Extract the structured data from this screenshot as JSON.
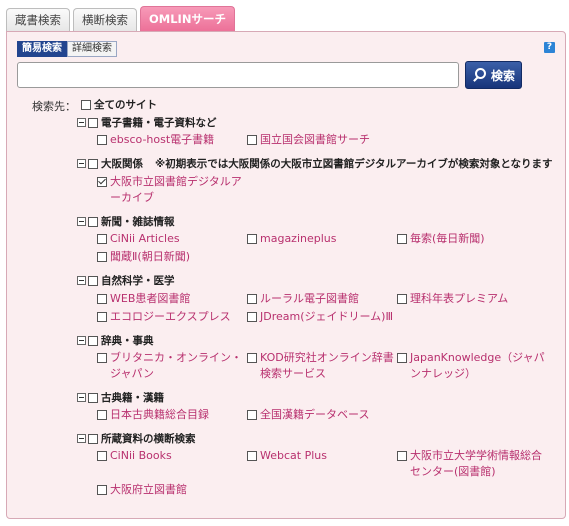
{
  "tabs": [
    {
      "label": "蔵書検索",
      "active": false
    },
    {
      "label": "横断検索",
      "active": false
    },
    {
      "label": "OMLINサーチ",
      "active": true
    }
  ],
  "subtabs": [
    {
      "label": "簡易検索",
      "active": true
    },
    {
      "label": "詳細検索",
      "active": false
    }
  ],
  "help_icon": "?",
  "search": {
    "value": "",
    "button_label": "検索",
    "button_icon": "search-icon"
  },
  "target_label": "検索先：",
  "all_sites_label": "全てのサイト",
  "categories": [
    {
      "name": "電子書籍・電子資料など",
      "items": [
        {
          "label": "ebsco-host電子書籍",
          "checked": false
        },
        {
          "label": "国立国会図書館サーチ",
          "checked": false
        }
      ]
    },
    {
      "name": "大阪関係",
      "note": "※初期表示では大阪関係の大阪市立図書館デジタルアーカイブが検索対象となります",
      "items": [
        {
          "label": "大阪市立図書館デジタルアーカイブ",
          "checked": true
        }
      ]
    },
    {
      "name": "新聞・雑誌情報",
      "items": [
        {
          "label": "CiNii Articles",
          "checked": false
        },
        {
          "label": "magazineplus",
          "checked": false
        },
        {
          "label": "毎索(毎日新聞)",
          "checked": false
        },
        {
          "label": "聞蔵Ⅱ(朝日新聞)",
          "checked": false
        }
      ]
    },
    {
      "name": "自然科学・医学",
      "items": [
        {
          "label": "WEB患者図書館",
          "checked": false
        },
        {
          "label": "ルーラル電子図書館",
          "checked": false
        },
        {
          "label": "理科年表プレミアム",
          "checked": false
        },
        {
          "label": "エコロジーエクスプレス",
          "checked": false
        },
        {
          "label": "JDream(ジェイドリーム)Ⅲ",
          "checked": false
        }
      ]
    },
    {
      "name": "辞典・事典",
      "items": [
        {
          "label": "ブリタニカ・オンライン・ジャパン",
          "checked": false
        },
        {
          "label": "KOD研究社オンライン辞書検索サービス",
          "checked": false
        },
        {
          "label": "JapanKnowledge（ジャパンナレッジ）",
          "checked": false
        }
      ]
    },
    {
      "name": "古典籍・漢籍",
      "items": [
        {
          "label": "日本古典籍総合目録",
          "checked": false
        },
        {
          "label": "全国漢籍データベース",
          "checked": false
        }
      ]
    },
    {
      "name": "所蔵資料の横断検索",
      "items": [
        {
          "label": "CiNii Books",
          "checked": false
        },
        {
          "label": "Webcat Plus",
          "checked": false
        },
        {
          "label": "大阪市立大学学術情報総合センター(図書館)",
          "checked": false
        },
        {
          "label": "大阪府立図書館",
          "checked": false
        }
      ]
    }
  ]
}
